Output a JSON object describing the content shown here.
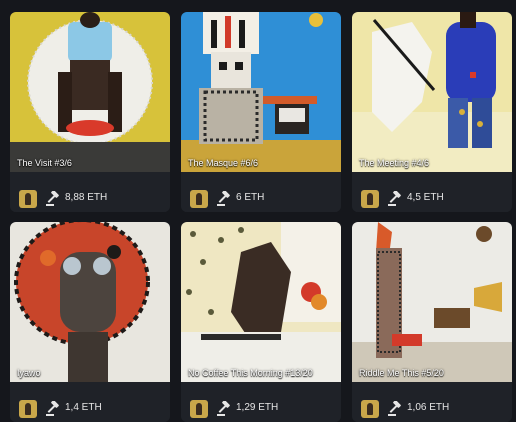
{
  "cards": [
    {
      "title": "The Visit #3/6",
      "price": "8,88 ETH",
      "art": "visit"
    },
    {
      "title": "The Masque #6/6",
      "price": "6 ETH",
      "art": "masque"
    },
    {
      "title": "The Meeting #4/6",
      "price": "4,5 ETH",
      "art": "meeting"
    },
    {
      "title": "Iyawo",
      "price": "1,4 ETH",
      "art": "iyawo"
    },
    {
      "title": "No Coffee This Morning #13/20",
      "price": "1,29 ETH",
      "art": "coffee"
    },
    {
      "title": "Riddle Me This #5/20",
      "price": "1,06 ETH",
      "art": "riddle"
    }
  ],
  "icons": {
    "avatar": "artist-avatar-icon",
    "bid": "gavel-icon"
  }
}
